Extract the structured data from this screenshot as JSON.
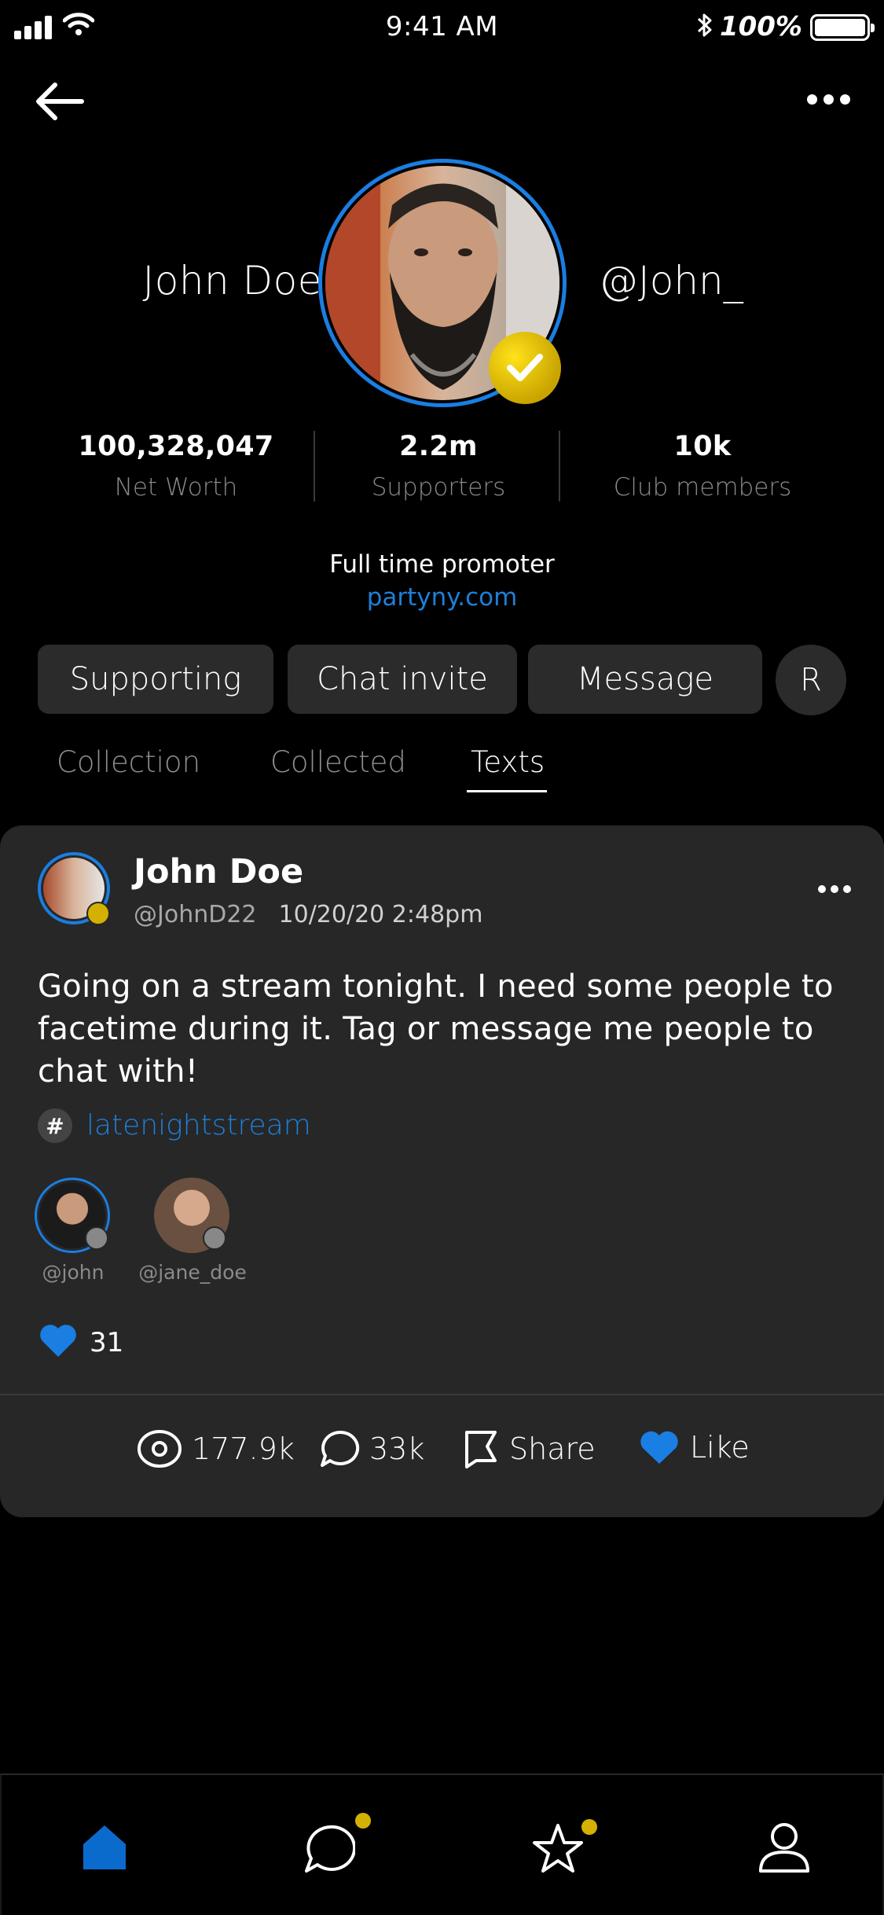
{
  "status_bar": {
    "time": "9:41 AM",
    "battery_pct": "100%"
  },
  "profile": {
    "name": "John Doe",
    "handle": "@John_",
    "verified": true,
    "stats": [
      {
        "value": "100,328,047",
        "label": "Net Worth"
      },
      {
        "value": "2.2m",
        "label": "Supporters"
      },
      {
        "value": "10k",
        "label": "Club members"
      }
    ],
    "bio": "Full time promoter",
    "link": "partyny.com"
  },
  "actions": {
    "supporting": "Supporting",
    "chat_invite": "Chat invite",
    "message": "Message",
    "r": "R"
  },
  "tabs": [
    {
      "label": "Collection",
      "active": false
    },
    {
      "label": "Collected",
      "active": false
    },
    {
      "label": "Texts",
      "active": true
    }
  ],
  "post": {
    "author_name": "John Doe",
    "author_handle": "@JohnD22",
    "datetime": "10/20/20  2:48pm",
    "text": "Going on a stream tonight. I need some people to facetime during it. Tag or message me people to chat with!",
    "hashtag": "latenightstream",
    "tagged_users": [
      "@john",
      "@jane_doe"
    ],
    "likes": "31",
    "views": "177.9k",
    "comments": "33k",
    "share_label": "Share",
    "like_label": "Like"
  },
  "colors": {
    "accent": "#1a7ee2",
    "verify": "#d4b100",
    "card": "#272727",
    "background": "#000000"
  },
  "bottom_nav": [
    {
      "icon": "home-icon",
      "active": true
    },
    {
      "icon": "chat-icon",
      "badge": true
    },
    {
      "icon": "star-icon",
      "badge": true
    },
    {
      "icon": "profile-icon"
    }
  ]
}
